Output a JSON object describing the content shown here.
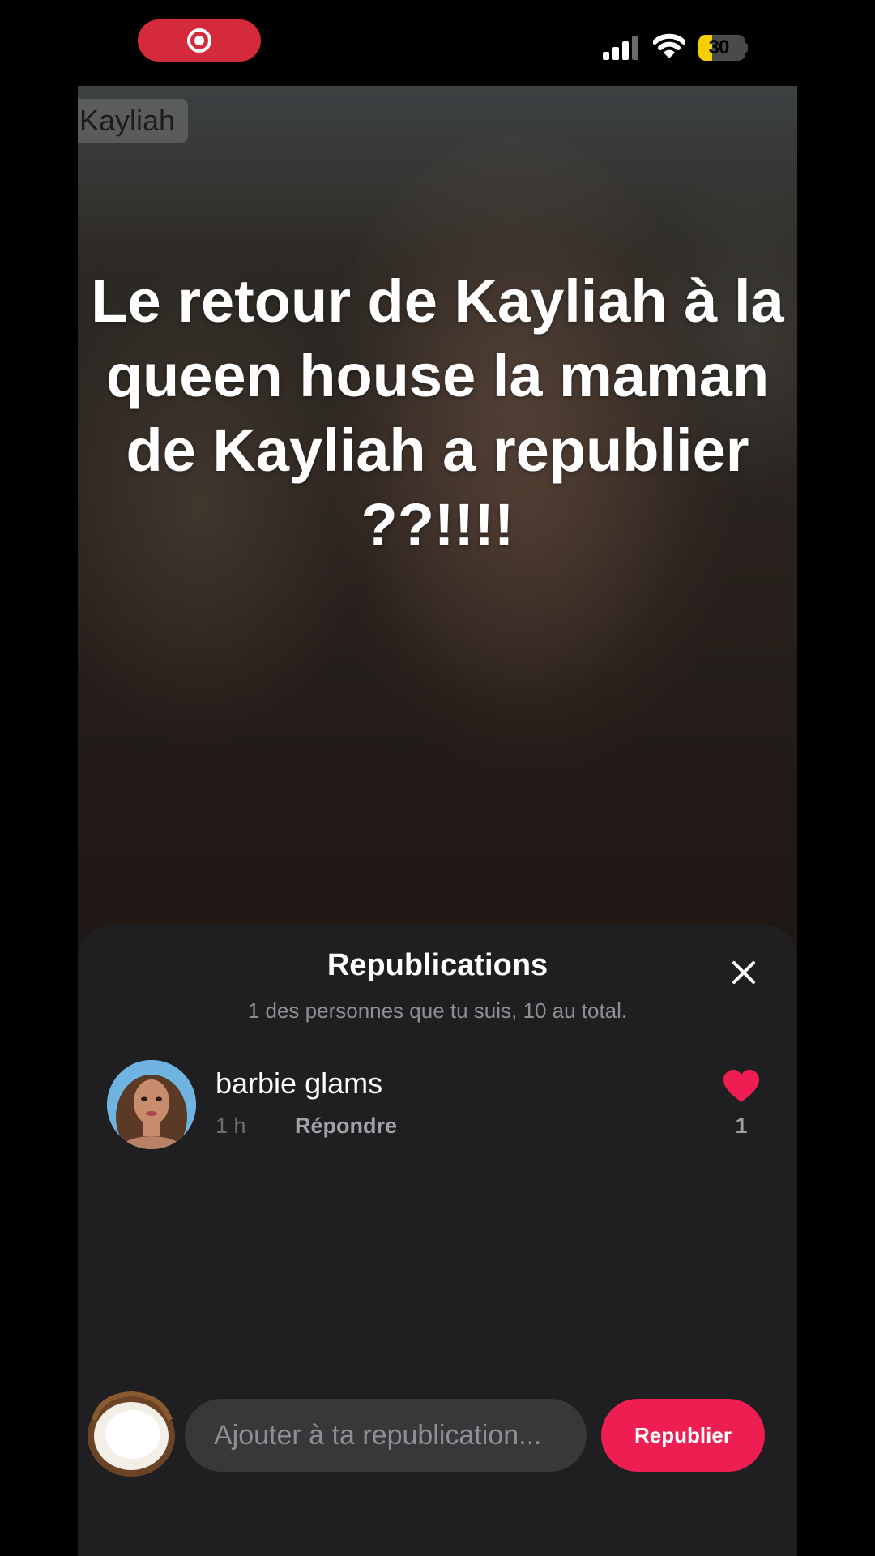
{
  "status_bar": {
    "battery_text": "30",
    "battery_level": 0.3,
    "icons": [
      "screen-record-icon",
      "signal-icon",
      "wifi-icon",
      "battery-icon"
    ],
    "record_color": "#d42a3b",
    "battery_color": "#f5d000"
  },
  "video": {
    "name_tag": "Kayliah",
    "caption": "Le retour de Kayliah à la queen house la maman de Kayliah a republier ??!!!!"
  },
  "sheet": {
    "title": "Republications",
    "subtitle": "1 des personnes que tu suis, 10 au total.",
    "close_icon": "close-icon",
    "reposts": [
      {
        "username": "barbie glams",
        "time": "1 h",
        "reply_label": "Répondre",
        "likes": "1",
        "heart_color": "#ee1d52"
      }
    ],
    "composer": {
      "placeholder": "Ajouter à ta republication...",
      "button_label": "Republier",
      "button_color": "#ee1d52",
      "avatar_icon": "coconut-avatar"
    }
  }
}
